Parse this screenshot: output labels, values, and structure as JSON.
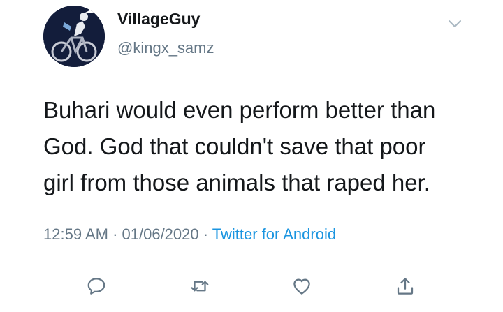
{
  "user": {
    "display_name": "VillageGuy",
    "handle": "@kingx_samz",
    "avatar_icon": "avatar-cyclist"
  },
  "tweet": {
    "lines": [
      "Buhari would even perform better than",
      "God. God that couldn't save that poor",
      "girl from those animals that raped her."
    ]
  },
  "meta": {
    "time": "12:59 AM",
    "separator": " · ",
    "date": "01/06/2020",
    "source": "Twitter for Android"
  },
  "actions": [
    {
      "name": "reply",
      "icon": "comment-icon"
    },
    {
      "name": "retweet",
      "icon": "retweet-icon"
    },
    {
      "name": "like",
      "icon": "heart-icon"
    },
    {
      "name": "share",
      "icon": "share-icon"
    }
  ],
  "colors": {
    "text": "#14171a",
    "secondary": "#657786",
    "link": "#1b95e0",
    "icon": "#657786"
  }
}
